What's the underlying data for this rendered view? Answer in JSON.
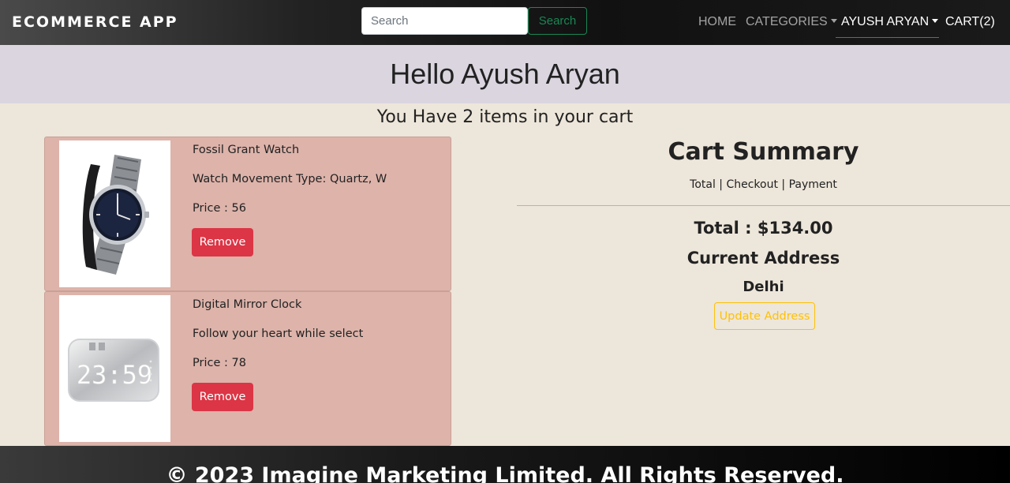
{
  "navbar": {
    "brand": "ECOMMERCE APP",
    "search": {
      "placeholder": "Search",
      "button_label": "Search"
    },
    "links": {
      "home": "HOME",
      "categories": "CATEGORIES",
      "user": "AYUSH ARYAN",
      "cart": "CART(2)"
    }
  },
  "greeting": "Hello Ayush Aryan",
  "cart_count_text": "You Have 2 items in your cart",
  "cart_items": [
    {
      "name": "Fossil Grant Watch",
      "description": "Watch Movement Type: Quartz, W",
      "price": "Price : 56",
      "remove_label": "Remove",
      "image_icon": "wristwatch-image"
    },
    {
      "name": "Digital Mirror Clock",
      "description": "Follow your heart while select",
      "price": "Price : 78",
      "remove_label": "Remove",
      "image_icon": "digital-clock-image",
      "clock_display": "23:59"
    }
  ],
  "summary": {
    "title": "Cart Summary",
    "subtitle": "Total | Checkout | Payment",
    "total": "Total : $134.00",
    "address_title": "Current Address",
    "address": "Delhi",
    "update_label": "Update Address"
  },
  "footer": "© 2023 Imagine Marketing Limited. All Rights Reserved.",
  "colors": {
    "remove_button": "#dc3545",
    "search_button": "#198754",
    "update_button": "#ffc107",
    "cart_item_bg": "#ddb3aa",
    "page_bg": "#ede6da"
  }
}
